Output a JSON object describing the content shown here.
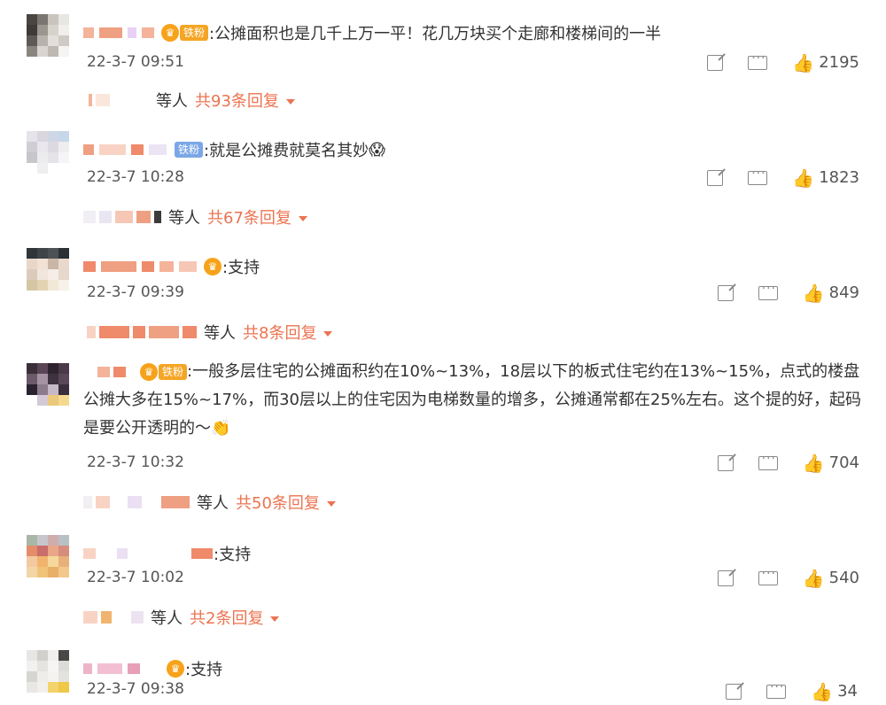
{
  "comments": [
    {
      "text": ":公摊面积也是几千上万一平！花几万块买个走廊和楼梯间的一半",
      "badge_tag": "铁粉",
      "time": "22-3-7 09:51",
      "likes": "2195",
      "replies_who": "等人",
      "replies_total": "共93条回复"
    },
    {
      "text": ":就是公摊费就莫名其妙",
      "emoji": "😱",
      "badge_tag": "铁粉",
      "time": "22-3-7 10:28",
      "likes": "1823",
      "replies_who": "等人",
      "replies_total": "共67条回复"
    },
    {
      "text": ":支持",
      "time": "22-3-7 09:39",
      "likes": "849",
      "replies_who": "等人",
      "replies_total": "共8条回复"
    },
    {
      "text": ":一般多层住宅的公摊面积约在10%~13%，18层以下的板式住宅约在13%~15%，点式的楼盘公摊大多在15%~17%，而30层以上的住宅因为电梯数量的增多，公摊通常都在25%左右。这个提的好，起码是要公开透明的～",
      "emoji": "👏",
      "badge_tag": "铁粉",
      "time": "22-3-7 10:32",
      "likes": "704",
      "replies_who": "等人",
      "replies_total": "共50条回复"
    },
    {
      "text": ":支持",
      "time": "22-3-7 10:02",
      "likes": "540",
      "replies_who": "等人",
      "replies_total": "共2条回复"
    },
    {
      "text": ":支持",
      "time": "22-3-7 09:38",
      "likes": "34"
    }
  ],
  "icons": {
    "share": "share-icon",
    "comment": "comment-icon",
    "like": "like-icon",
    "crown_glyph": "♛",
    "like_glyph": "👍"
  },
  "colors": {
    "accent": "#eb7350",
    "fan_badge_blue": "#7ba7e6",
    "fan_badge_gold": "#f5a524"
  }
}
